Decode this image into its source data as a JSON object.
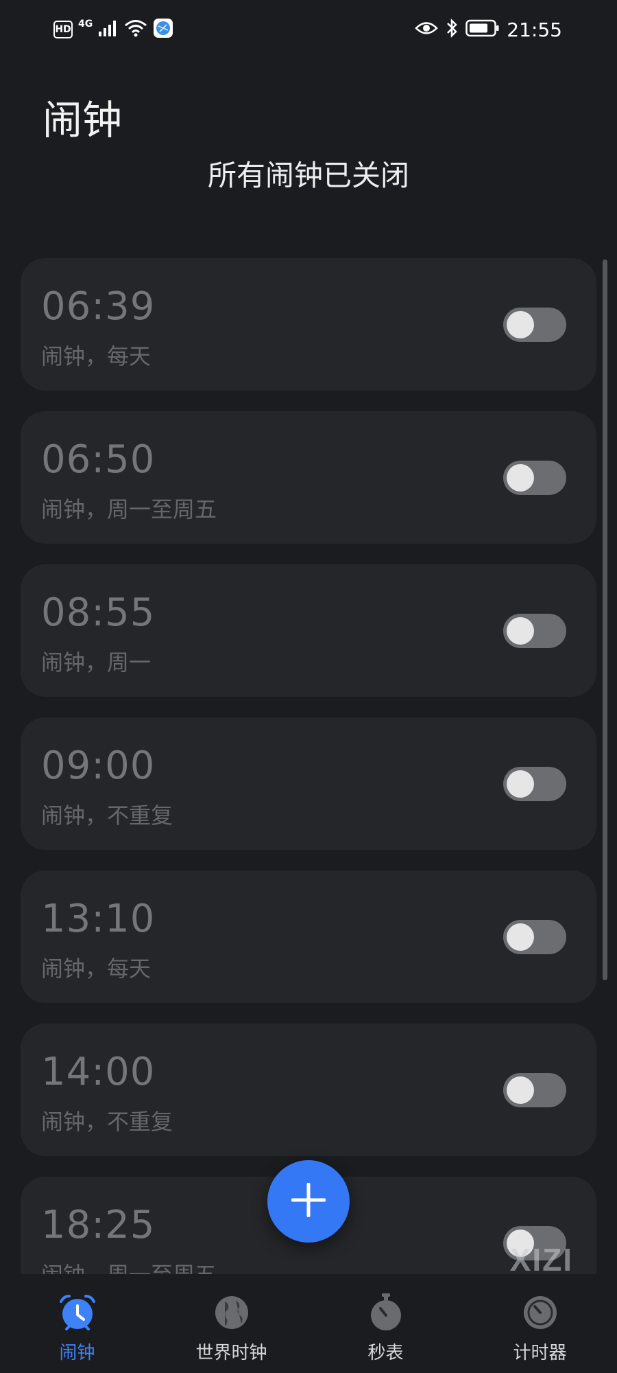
{
  "status_bar": {
    "hd": "HD",
    "network": "4G",
    "time": "21:55"
  },
  "header": {
    "title": "闹钟",
    "summary": "所有闹钟已关闭"
  },
  "alarms": [
    {
      "time": "06:39",
      "desc": "闹钟，每天",
      "enabled": false
    },
    {
      "time": "06:50",
      "desc": "闹钟，周一至周五",
      "enabled": false
    },
    {
      "time": "08:55",
      "desc": "闹钟，周一",
      "enabled": false
    },
    {
      "time": "09:00",
      "desc": "闹钟，不重复",
      "enabled": false
    },
    {
      "time": "13:10",
      "desc": "闹钟，每天",
      "enabled": false
    },
    {
      "time": "14:00",
      "desc": "闹钟，不重复",
      "enabled": false
    },
    {
      "time": "18:25",
      "desc": "闹钟，周一至周五",
      "enabled": false
    }
  ],
  "watermark": "XIZI",
  "nav": {
    "items": [
      {
        "label": "闹钟",
        "icon": "alarm-clock-icon",
        "active": true
      },
      {
        "label": "世界时钟",
        "icon": "globe-icon",
        "active": false
      },
      {
        "label": "秒表",
        "icon": "stopwatch-icon",
        "active": false
      },
      {
        "label": "计时器",
        "icon": "timer-icon",
        "active": false
      }
    ]
  },
  "colors": {
    "accent": "#3478f6",
    "background": "#1b1c20",
    "card": "#252629"
  }
}
